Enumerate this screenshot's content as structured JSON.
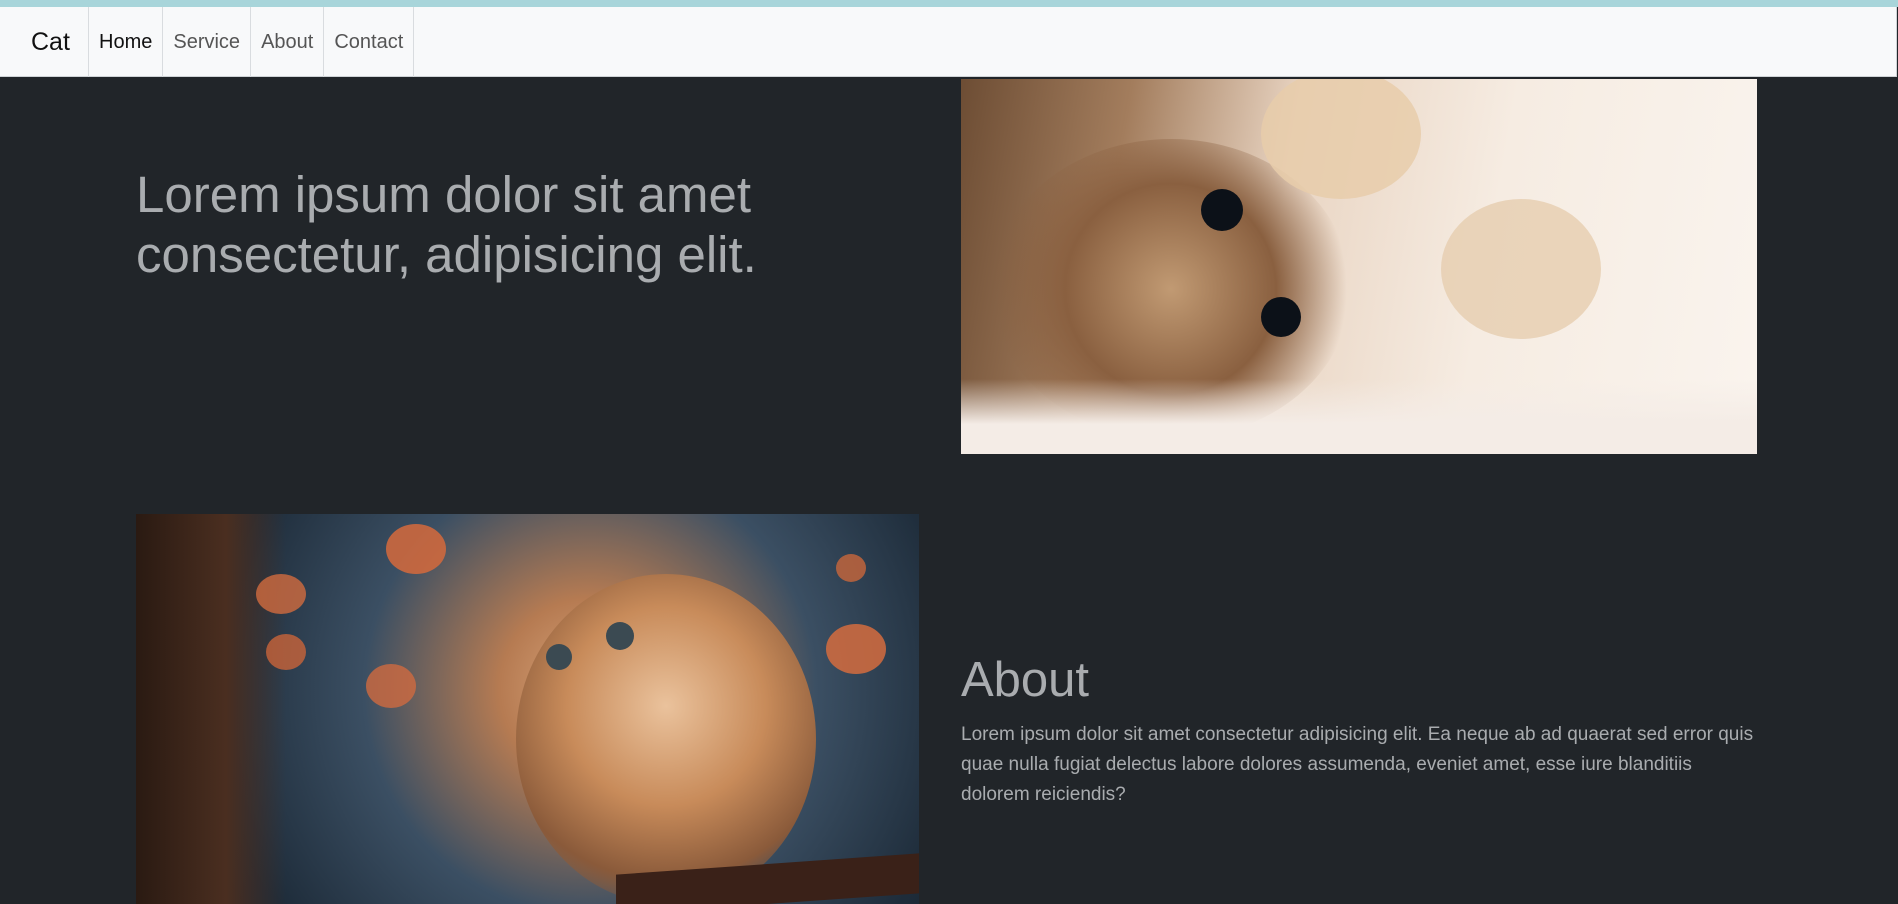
{
  "nav": {
    "brand": "Cat",
    "links": [
      {
        "label": "Home"
      },
      {
        "label": "Service"
      },
      {
        "label": "About"
      },
      {
        "label": "Contact"
      }
    ]
  },
  "hero": {
    "title": "Lorem ipsum dolor sit amet consectetur, adipisicing elit."
  },
  "about": {
    "title": "About",
    "text": "Lorem ipsum dolor sit amet consectetur adipisicing elit. Ea neque ab ad quaerat sed error quis quae nulla fugiat delectus labore dolores assumenda, eveniet amet, esse iure blanditiis dolorem reiciendis?"
  },
  "colors": {
    "background": "#212529",
    "navbar": "#f8f9fa",
    "top_accent": "#a8d5da",
    "text_muted": "#a9acaf"
  }
}
